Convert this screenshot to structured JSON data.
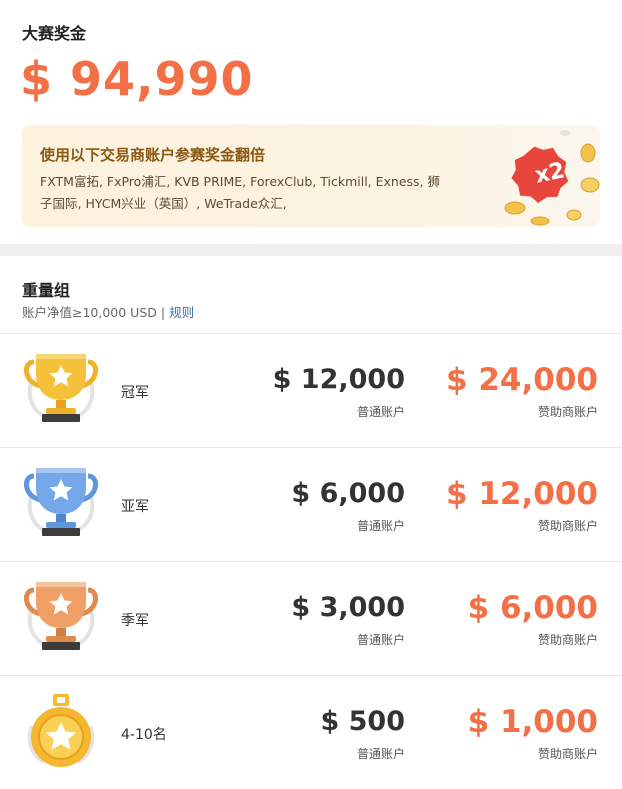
{
  "prize": {
    "title": "大赛奖金",
    "total": "$ 94,990"
  },
  "promo": {
    "title": "使用以下交易商账户参赛奖金翻倍",
    "brokers": "FXTM富拓, FxPro浦汇, KVB PRIME, ForexClub, Tickmill, Exness, 狮子国际, HYCM兴业（英国）, WeTrade众汇,",
    "badge": "x2",
    "colors": {
      "badge": "#e8453c",
      "coin": "#f3c24a"
    }
  },
  "group": {
    "title": "重量组",
    "subtitle": "账户净值≥10,000 USD | ",
    "rule_link": "规则"
  },
  "rows": [
    {
      "rank": "冠军",
      "icon": "gold-trophy-icon",
      "std_amount": "$ 12,000",
      "std_label": "普通账户",
      "sponsor_amount": "$ 24,000",
      "sponsor_label": "赞助商账户"
    },
    {
      "rank": "亚军",
      "icon": "silver-trophy-icon",
      "std_amount": "$ 6,000",
      "std_label": "普通账户",
      "sponsor_amount": "$ 12,000",
      "sponsor_label": "赞助商账户"
    },
    {
      "rank": "季军",
      "icon": "bronze-trophy-icon",
      "std_amount": "$ 3,000",
      "std_label": "普通账户",
      "sponsor_amount": "$ 6,000",
      "sponsor_label": "赞助商账户"
    },
    {
      "rank": "4-10名",
      "icon": "medal-icon",
      "std_amount": "$ 500",
      "std_label": "普通账户",
      "sponsor_amount": "$ 1,000",
      "sponsor_label": "赞助商账户"
    }
  ],
  "colors": {
    "accent": "#f36f45",
    "link": "#3a6fb0"
  }
}
